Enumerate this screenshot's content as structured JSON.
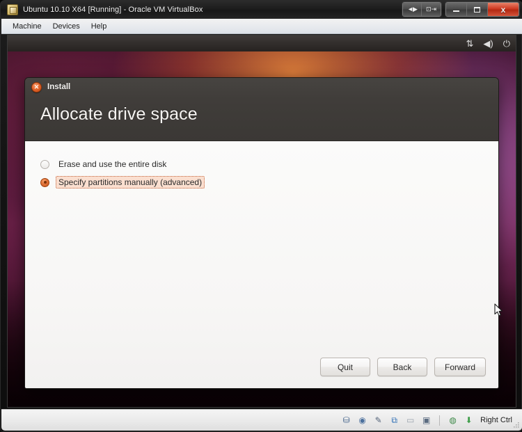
{
  "host_window": {
    "title": "Ubuntu 10.10 X64 [Running] - Oracle VM VirtualBox",
    "icon": "virtualbox-icon",
    "controls": {
      "scale_mode_label": "◄►",
      "seamless_label": "⇥",
      "minimize_label": "",
      "maximize_label": "",
      "close_label": "x"
    }
  },
  "menubar": {
    "items": [
      {
        "label": "Machine",
        "name": "menu-machine"
      },
      {
        "label": "Devices",
        "name": "menu-devices"
      },
      {
        "label": "Help",
        "name": "menu-help"
      }
    ]
  },
  "ubuntu_panel": {
    "indicators": [
      {
        "name": "network-icon",
        "glyph": "⇅"
      },
      {
        "name": "volume-icon",
        "glyph": "◀)"
      },
      {
        "name": "power-icon",
        "glyph": "⏻"
      }
    ]
  },
  "install_dialog": {
    "window_title": "Install",
    "close_glyph": "✕",
    "page_heading": "Allocate drive space",
    "options": [
      {
        "label": "Erase and use the entire disk",
        "selected": false,
        "focused": false,
        "name": "radio-erase-entire-disk"
      },
      {
        "label": "Specify partitions manually (advanced)",
        "selected": true,
        "focused": true,
        "name": "radio-specify-partitions-manually"
      }
    ],
    "buttons": [
      {
        "label": "Quit",
        "name": "quit-button"
      },
      {
        "label": "Back",
        "name": "back-button"
      },
      {
        "label": "Forward",
        "name": "forward-button"
      }
    ]
  },
  "statusbar": {
    "icons": [
      {
        "name": "hard-disk-icon",
        "glyph": "⛁"
      },
      {
        "name": "cd-dvd-icon",
        "glyph": "◉"
      },
      {
        "name": "floppy-icon",
        "glyph": "✎"
      },
      {
        "name": "network-adapter-icon",
        "glyph": "⧉"
      },
      {
        "name": "shared-folders-icon",
        "glyph": "▭"
      },
      {
        "name": "cpu-icon",
        "glyph": "▣"
      }
    ],
    "right_icons": [
      {
        "name": "remote-display-icon",
        "glyph": "◍"
      },
      {
        "name": "host-key-icon",
        "glyph": "⬇"
      }
    ],
    "host_key_label": "Right Ctrl"
  },
  "colors": {
    "ubuntu_orange": "#e3753b",
    "dialog_header": "#403d3a",
    "focus_highlight": "#fadfd0",
    "close_red": "#cf3a22"
  }
}
